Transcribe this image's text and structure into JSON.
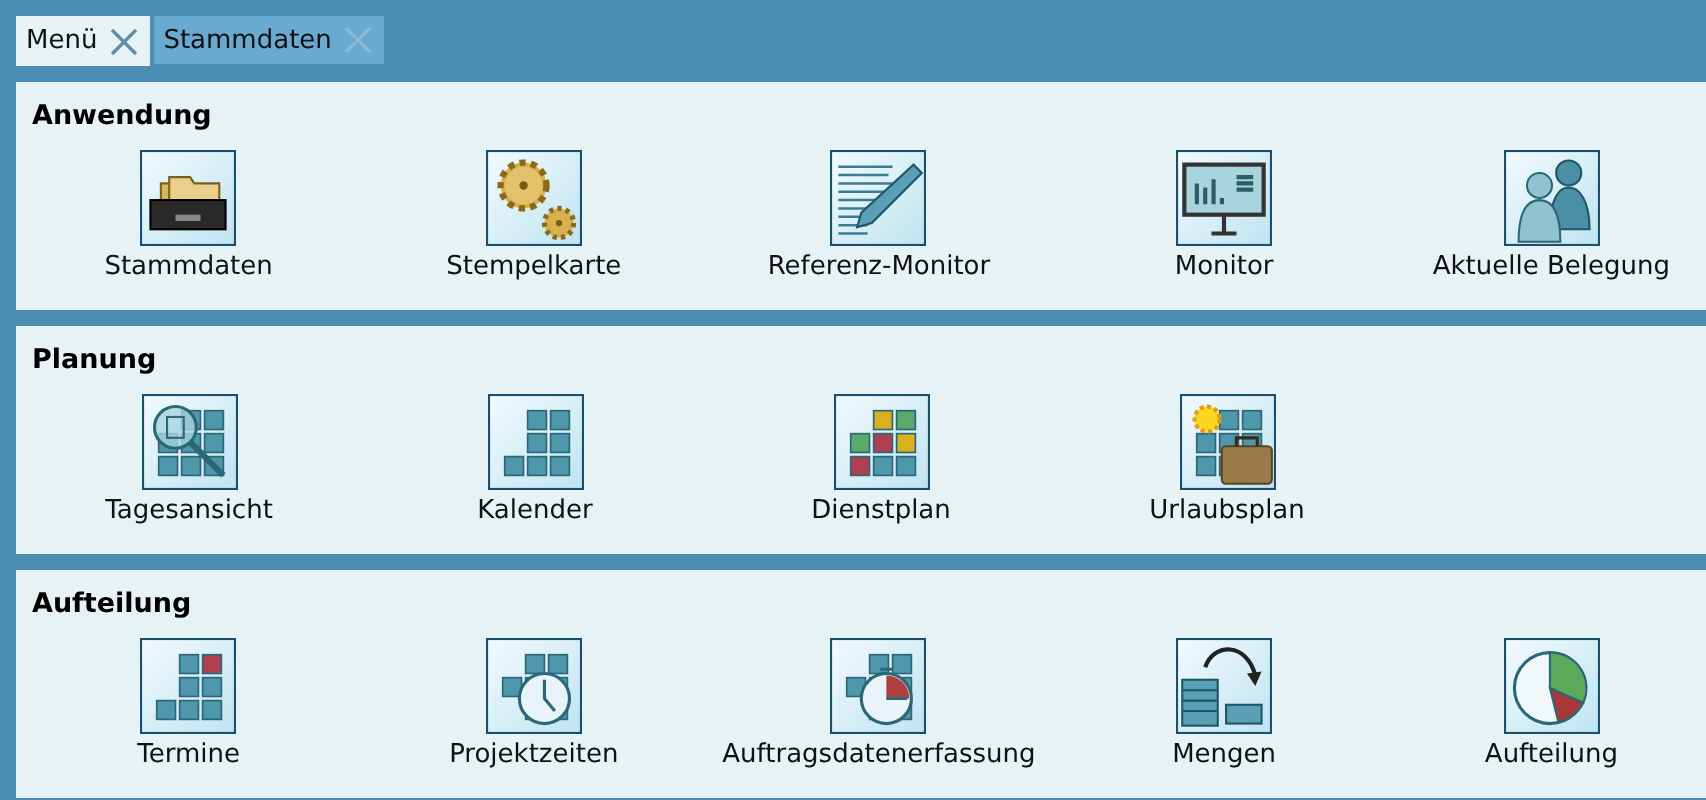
{
  "tabs": [
    {
      "label": "Menü",
      "selected": true
    },
    {
      "label": "Stammdaten",
      "selected": false
    }
  ],
  "sections": [
    {
      "title": "Anwendung",
      "items": [
        {
          "label": "Stammdaten"
        },
        {
          "label": "Stempelkarte"
        },
        {
          "label": "Referenz-Monitor"
        },
        {
          "label": "Monitor"
        },
        {
          "label": "Aktuelle Belegung"
        }
      ]
    },
    {
      "title": "Planung",
      "items": [
        {
          "label": "Tagesansicht"
        },
        {
          "label": "Kalender"
        },
        {
          "label": "Dienstplan"
        },
        {
          "label": "Urlaubsplan"
        }
      ]
    },
    {
      "title": "Aufteilung",
      "items": [
        {
          "label": "Termine"
        },
        {
          "label": "Projektzeiten"
        },
        {
          "label": "Auftragsdatenerfassung"
        },
        {
          "label": "Mengen"
        },
        {
          "label": "Aufteilung"
        }
      ]
    }
  ]
}
